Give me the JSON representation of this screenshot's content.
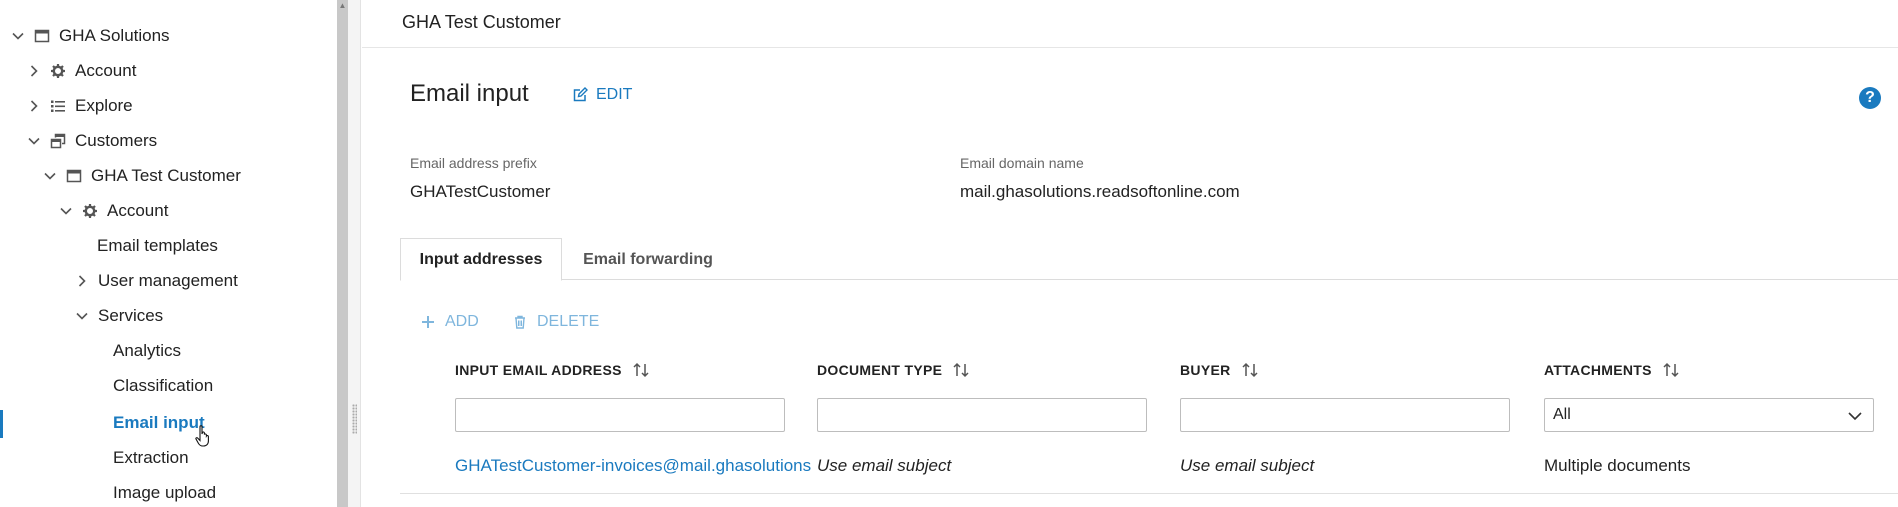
{
  "sidebar": {
    "items": [
      {
        "label": "GHA Solutions"
      },
      {
        "label": "Account"
      },
      {
        "label": "Explore"
      },
      {
        "label": "Customers"
      },
      {
        "label": "GHA Test Customer"
      },
      {
        "label": "Account"
      },
      {
        "label": "Email templates"
      },
      {
        "label": "User management"
      },
      {
        "label": "Services"
      },
      {
        "label": "Analytics"
      },
      {
        "label": "Classification"
      },
      {
        "label": "Email input"
      },
      {
        "label": "Extraction"
      },
      {
        "label": "Image upload"
      }
    ]
  },
  "topbar": {
    "title": "GHA Test Customer"
  },
  "page": {
    "title": "Email input",
    "edit_label": "EDIT",
    "help_label": "?"
  },
  "fields": {
    "prefix_label": "Email address prefix",
    "prefix_value": "GHATestCustomer",
    "domain_label": "Email domain name",
    "domain_value": "mail.ghasolutions.readsoftonline.com"
  },
  "tabs": [
    {
      "label": "Input addresses",
      "active": true
    },
    {
      "label": "Email forwarding",
      "active": false
    }
  ],
  "actions": {
    "add_label": "ADD",
    "delete_label": "DELETE"
  },
  "table": {
    "columns": [
      {
        "label": "INPUT EMAIL ADDRESS"
      },
      {
        "label": "DOCUMENT TYPE"
      },
      {
        "label": "BUYER"
      },
      {
        "label": "ATTACHMENTS"
      }
    ],
    "filters": {
      "attachments_selected": "All"
    },
    "rows": [
      {
        "email": "GHATestCustomer-invoices@mail.ghasolutions",
        "document_type": "Use email subject",
        "buyer": "Use email subject",
        "attachments": "Multiple documents"
      }
    ]
  },
  "colors": {
    "accent": "#1a7abf",
    "accent_disabled": "#7fb6dd"
  }
}
